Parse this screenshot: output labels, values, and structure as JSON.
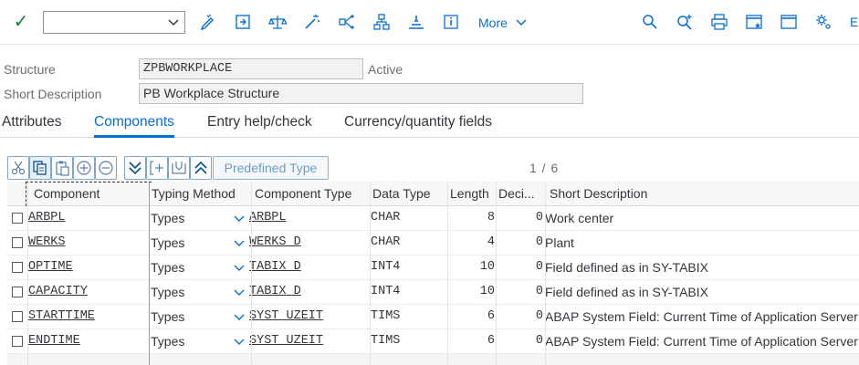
{
  "toolbar": {
    "combo_value": "",
    "more_label": "More",
    "exit_label": "E"
  },
  "header": {
    "structure_label": "Structure",
    "structure_value": "ZPBWORKPLACE",
    "status": "Active",
    "short_desc_label": "Short Description",
    "short_desc_value": "PB Workplace Structure"
  },
  "tabs": [
    {
      "label": "Attributes"
    },
    {
      "label": "Components"
    },
    {
      "label": "Entry help/check"
    },
    {
      "label": "Currency/quantity fields"
    }
  ],
  "table_toolbar": {
    "predefined_type_label": "Predefined Type",
    "row_counter": "1 / 6"
  },
  "table": {
    "columns": [
      "Component",
      "Typing Method",
      "Component Type",
      "Data Type",
      "Length",
      "Deci...",
      "Short Description"
    ],
    "rows": [
      {
        "component": "ARBPL",
        "typing": "Types",
        "comp_type": "ARBPL",
        "data_type": "CHAR",
        "length": "8",
        "decimals": "0",
        "desc": "Work center"
      },
      {
        "component": "WERKS",
        "typing": "Types",
        "comp_type": "WERKS_D",
        "data_type": "CHAR",
        "length": "4",
        "decimals": "0",
        "desc": "Plant"
      },
      {
        "component": "OPTIME",
        "typing": "Types",
        "comp_type": "TABIX_D",
        "data_type": "INT4",
        "length": "10",
        "decimals": "0",
        "desc": "Field defined as in SY-TABIX"
      },
      {
        "component": "CAPACITY",
        "typing": "Types",
        "comp_type": "TABIX_D",
        "data_type": "INT4",
        "length": "10",
        "decimals": "0",
        "desc": "Field defined as in SY-TABIX"
      },
      {
        "component": "STARTTIME",
        "typing": "Types",
        "comp_type": "SYST_UZEIT",
        "data_type": "TIMS",
        "length": "6",
        "decimals": "0",
        "desc": "ABAP System Field: Current Time of Application Server"
      },
      {
        "component": "ENDTIME",
        "typing": "Types",
        "comp_type": "SYST_UZEIT",
        "data_type": "TIMS",
        "length": "6",
        "decimals": "0",
        "desc": "ABAP System Field: Current Time of Application Server"
      }
    ]
  },
  "colors": {
    "accent": "#0a6ed1",
    "confirm_green": "#107e3e"
  }
}
